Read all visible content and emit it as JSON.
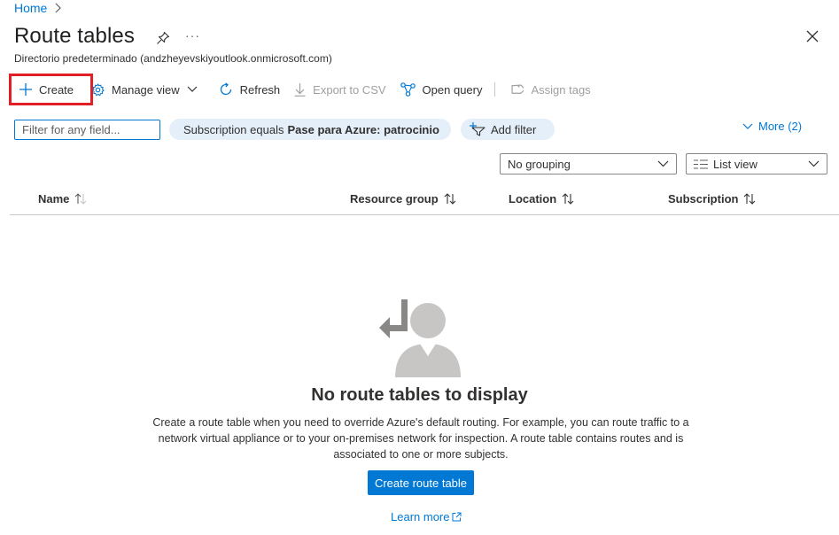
{
  "breadcrumb": {
    "home": "Home"
  },
  "page": {
    "title": "Route tables",
    "subtitle": "Directorio predeterminado (andzheyevskiyoutlook.onmicrosoft.com)",
    "more_menu": "···"
  },
  "toolbar": {
    "create": "Create",
    "manage_view": "Manage view",
    "refresh": "Refresh",
    "export_csv": "Export to CSV",
    "open_query": "Open query",
    "assign_tags": "Assign tags"
  },
  "filters": {
    "placeholder": "Filter for any field...",
    "subscription_prefix": "Subscription equals",
    "subscription_value": "Pase para Azure: patrocinio",
    "add_filter": "Add filter",
    "more": "More (2)"
  },
  "view_options": {
    "grouping": "No grouping",
    "view": "List view"
  },
  "table": {
    "columns": [
      "Name",
      "Resource group",
      "Location",
      "Subscription"
    ]
  },
  "empty_state": {
    "title": "No route tables to display",
    "description": "Create a route table when you need to override Azure's default routing. For example, you can route traffic to a network virtual appliance or to your on-premises network for inspection. A route table contains routes and is associated to one or more subjects.",
    "cta": "Create route table",
    "learn_more": "Learn more"
  },
  "colors": {
    "accent": "#0078d4",
    "highlight_box": "#e01f26",
    "pill_bg": "#e4effa"
  }
}
